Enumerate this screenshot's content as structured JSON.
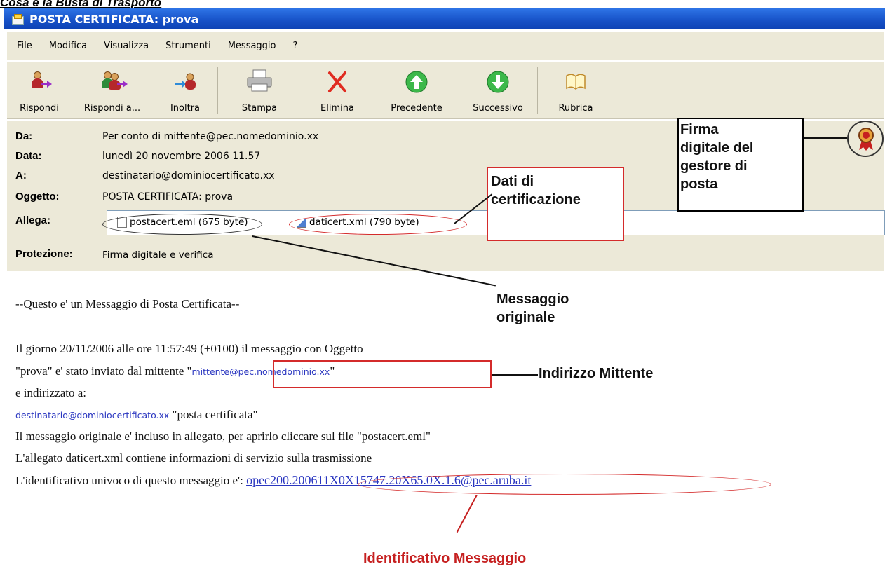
{
  "caption": "Cosa è la Busta di Trasporto",
  "window": {
    "title": "POSTA CERTIFICATA: prova"
  },
  "menu": [
    "File",
    "Modifica",
    "Visualizza",
    "Strumenti",
    "Messaggio",
    "?"
  ],
  "toolbar": [
    {
      "label": "Rispondi",
      "icon": "reply-icon"
    },
    {
      "label": "Rispondi a...",
      "icon": "reply-all-icon"
    },
    {
      "label": "Inoltra",
      "icon": "forward-icon"
    },
    {
      "label": "Stampa",
      "icon": "printer-icon"
    },
    {
      "label": "Elimina",
      "icon": "delete-icon"
    },
    {
      "label": "Precedente",
      "icon": "up-arrow-icon"
    },
    {
      "label": "Successivo",
      "icon": "down-arrow-icon"
    },
    {
      "label": "Rubrica",
      "icon": "address-book-icon"
    }
  ],
  "headers": {
    "from_label": "Da:",
    "from": "Per conto di mittente@pec.nomedominio.xx",
    "date_label": "Data:",
    "date": "lunedì 20 novembre 2006 11.57",
    "to_label": "A:",
    "to": "destinatario@dominiocertificato.xx",
    "subject_label": "Oggetto:",
    "subject": "POSTA CERTIFICATA: prova",
    "attach_label": "Allega:",
    "attachments": [
      "postacert.eml (675 byte)",
      "daticert.xml (790 byte)"
    ],
    "protection_label": "Protezione:",
    "protection": "Firma digitale e verifica"
  },
  "body": {
    "line1": "--Questo e' un Messaggio di Posta Certificata--",
    "line2": "Il giorno 20/11/2006 alle ore 11:57:49 (+0100) il messaggio con Oggetto",
    "line3_pre": "\"prova\" e' stato inviato dal mittente \"",
    "sender": "mittente@pec.nomedominio.xx",
    "line3_post": "\"",
    "line4": "e indirizzato a:",
    "recipient": "destinatario@dominiocertificato.xx",
    "recipient_post": " \"posta certificata\"",
    "line6": "Il messaggio originale e' incluso in allegato, per aprirlo cliccare sul file \"postacert.eml\"",
    "line7": "L'allegato daticert.xml contiene informazioni di servizio sulla trasmissione",
    "line8_pre": "L'identificativo univoco di questo messaggio e': ",
    "msg_id": "opec200.200611X0X15747.20X65.0X.1.6@pec.aruba.it"
  },
  "annotations": {
    "firma_1": "Firma",
    "firma_2": "digitale del",
    "firma_3": "gestore di",
    "firma_4": "posta",
    "dati_1": "Dati di",
    "dati_2": "certificazione",
    "msg_orig_1": "Messaggio",
    "msg_orig_2": "originale",
    "mittente": "Indirizzo Mittente",
    "identificativo": "Identificativo Messaggio"
  }
}
